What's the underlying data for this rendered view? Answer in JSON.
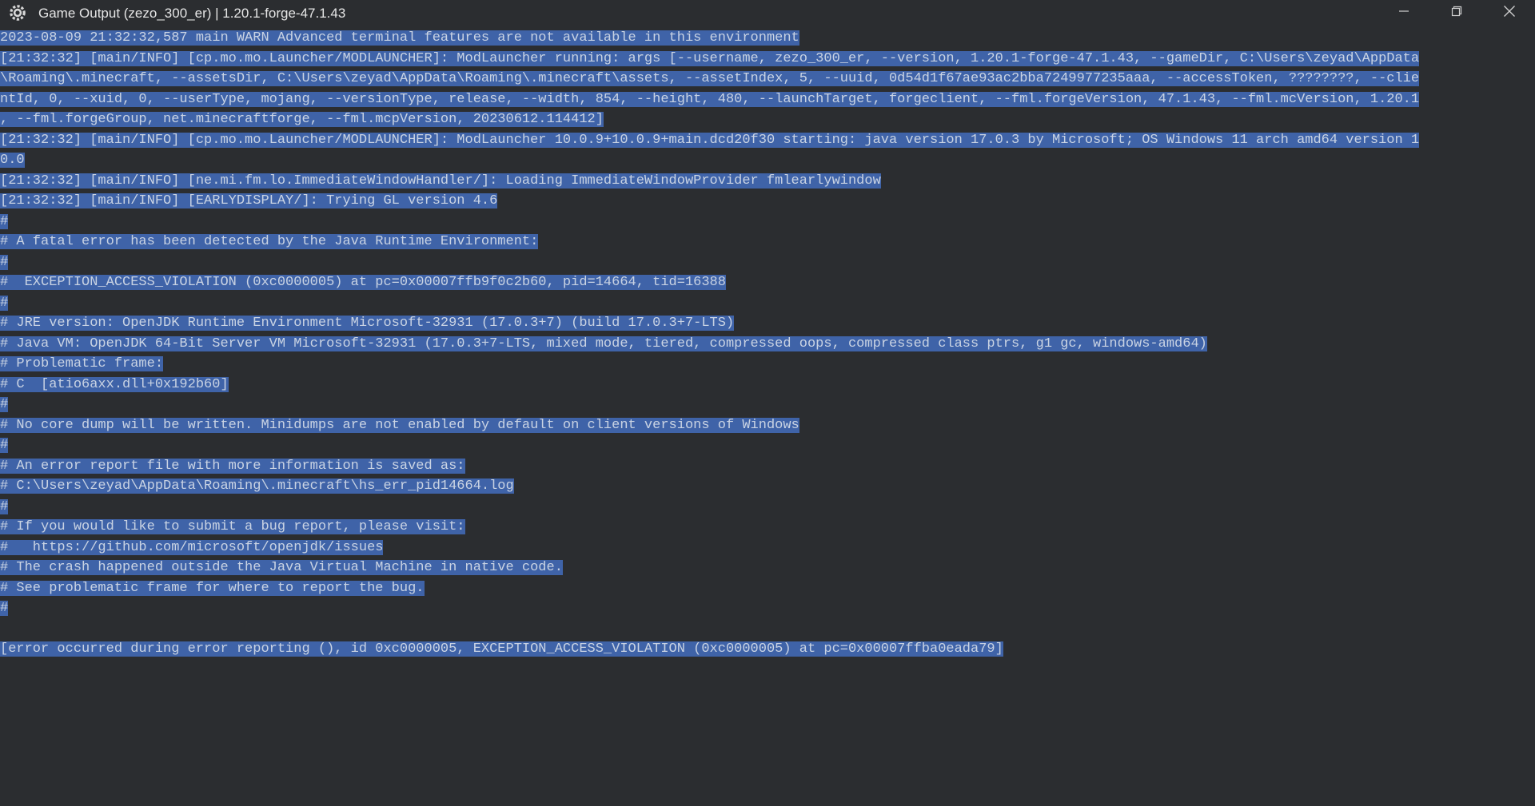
{
  "window": {
    "title": "Game Output (zezo_300_er) | 1.20.1-forge-47.1.43",
    "icon": "curseforge-gear-icon",
    "controls": [
      "minimize-icon",
      "restore-icon",
      "close-icon"
    ],
    "colors": {
      "background": "#2b2d30",
      "selection": "#3f63a8",
      "text": "#c9d3e3"
    }
  },
  "console": {
    "lines": [
      "2023-08-09 21:32:32,587 main WARN Advanced terminal features are not available in this environment",
      "[21:32:32] [main/INFO] [cp.mo.mo.Launcher/MODLAUNCHER]: ModLauncher running: args [--username, zezo_300_er, --version, 1.20.1-forge-47.1.43, --gameDir, C:\\Users\\zeyad\\AppData",
      "\\Roaming\\.minecraft, --assetsDir, C:\\Users\\zeyad\\AppData\\Roaming\\.minecraft\\assets, --assetIndex, 5, --uuid, 0d54d1f67ae93ac2bba7249977235aaa, --accessToken, ????????, --clie",
      "ntId, 0, --xuid, 0, --userType, mojang, --versionType, release, --width, 854, --height, 480, --launchTarget, forgeclient, --fml.forgeVersion, 47.1.43, --fml.mcVersion, 1.20.1",
      ", --fml.forgeGroup, net.minecraftforge, --fml.mcpVersion, 20230612.114412]",
      "[21:32:32] [main/INFO] [cp.mo.mo.Launcher/MODLAUNCHER]: ModLauncher 10.0.9+10.0.9+main.dcd20f30 starting: java version 17.0.3 by Microsoft; OS Windows 11 arch amd64 version 1",
      "0.0",
      "[21:32:32] [main/INFO] [ne.mi.fm.lo.ImmediateWindowHandler/]: Loading ImmediateWindowProvider fmlearlywindow",
      "[21:32:32] [main/INFO] [EARLYDISPLAY/]: Trying GL version 4.6",
      "#",
      "# A fatal error has been detected by the Java Runtime Environment:",
      "#",
      "#  EXCEPTION_ACCESS_VIOLATION (0xc0000005) at pc=0x00007ffb9f0c2b60, pid=14664, tid=16388",
      "#",
      "# JRE version: OpenJDK Runtime Environment Microsoft-32931 (17.0.3+7) (build 17.0.3+7-LTS)",
      "# Java VM: OpenJDK 64-Bit Server VM Microsoft-32931 (17.0.3+7-LTS, mixed mode, tiered, compressed oops, compressed class ptrs, g1 gc, windows-amd64)",
      "# Problematic frame:",
      "# C  [atio6axx.dll+0x192b60]",
      "#",
      "# No core dump will be written. Minidumps are not enabled by default on client versions of Windows",
      "#",
      "# An error report file with more information is saved as:",
      "# C:\\Users\\zeyad\\AppData\\Roaming\\.minecraft\\hs_err_pid14664.log",
      "#",
      "# If you would like to submit a bug report, please visit:",
      "#   https://github.com/microsoft/openjdk/issues",
      "# The crash happened outside the Java Virtual Machine in native code.",
      "# See problematic frame for where to report the bug.",
      "#",
      "",
      "[error occurred during error reporting (), id 0xc0000005, EXCEPTION_ACCESS_VIOLATION (0xc0000005) at pc=0x00007ffba0eada79]"
    ]
  }
}
